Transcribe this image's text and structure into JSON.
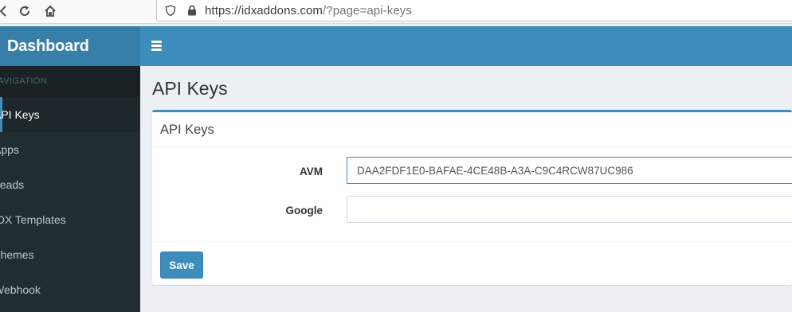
{
  "browser": {
    "url_host": "https://idxaddons.com",
    "url_path": "/?page=api-keys"
  },
  "sidebar": {
    "logo": "Dashboard",
    "nav_header": "NAVIGATION",
    "items": [
      {
        "label": "API Keys",
        "active": true
      },
      {
        "label": "Apps",
        "active": false
      },
      {
        "label": "Leads",
        "active": false
      },
      {
        "label": "IDX Templates",
        "active": false
      },
      {
        "label": "Themes",
        "active": false
      },
      {
        "label": "Webhook",
        "active": false
      }
    ]
  },
  "header": {
    "menu_icon": "hamburger-icon"
  },
  "main": {
    "page_title": "API Keys",
    "box_title": "API Keys",
    "fields": [
      {
        "label": "AVM",
        "value": "DAA2FDF1E0-BAFAE-4CE48B-A3A-C9C4RCW87UC986",
        "placeholder": ""
      },
      {
        "label": "Google",
        "value": "",
        "placeholder": ""
      }
    ],
    "save_label": "Save"
  },
  "colors": {
    "accent": "#3c8dbc",
    "logo_bg": "#367fa9",
    "sidebar_bg": "#222d32",
    "content_bg": "#ecf0f5"
  }
}
